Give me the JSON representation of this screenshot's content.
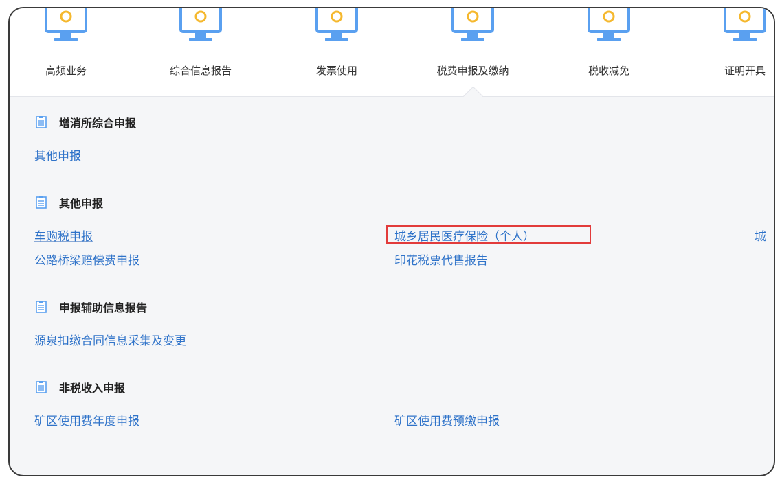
{
  "nav": {
    "items": [
      {
        "label": "高频业务"
      },
      {
        "label": "综合信息报告"
      },
      {
        "label": "发票使用"
      },
      {
        "label": "税费申报及缴纳"
      },
      {
        "label": "税收减免"
      },
      {
        "label": "证明开具"
      }
    ],
    "active_index": 3,
    "icon": "monitor-icon"
  },
  "sections": [
    {
      "title": "增消所综合申报",
      "links": [
        "其他申报"
      ]
    },
    {
      "title": "其他申报",
      "links": [
        "车购税申报",
        "城乡居民医疗保险（个人）",
        "城",
        "公路桥梁赔偿费申报",
        "印花税票代售报告"
      ]
    },
    {
      "title": "申报辅助信息报告",
      "links": [
        "源泉扣缴合同信息采集及变更"
      ]
    },
    {
      "title": "非税收入申报",
      "links": [
        "矿区使用费年度申报",
        "矿区使用费预缴申报"
      ]
    }
  ],
  "colors": {
    "link": "#2f73c9",
    "highlight_border": "#e23b3b",
    "icon_blue": "#5aa0f0",
    "icon_yellow": "#f5b82e"
  }
}
